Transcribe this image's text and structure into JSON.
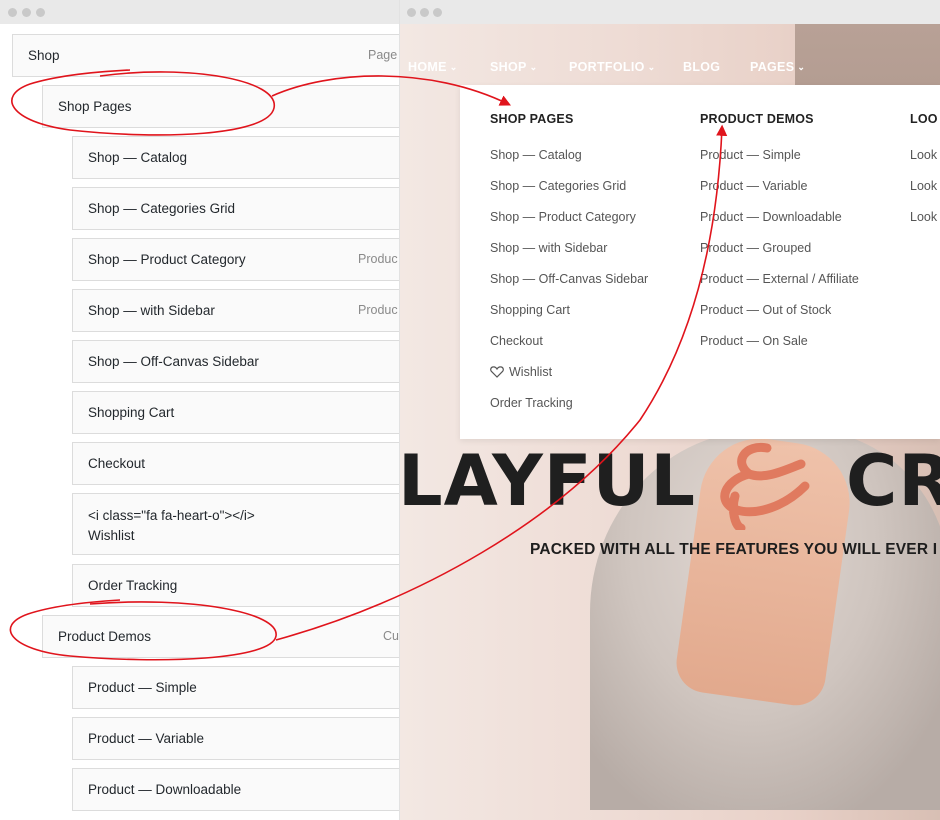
{
  "menu_editor": {
    "items": [
      {
        "label": "Shop",
        "type": "Page"
      },
      {
        "label": "Shop Pages",
        "type": ""
      },
      {
        "label": "Shop — Catalog",
        "type": ""
      },
      {
        "label": "Shop — Categories Grid",
        "type": ""
      },
      {
        "label": "Shop — Product Category",
        "type": "Produc"
      },
      {
        "label": "Shop — with Sidebar",
        "type": "Produc"
      },
      {
        "label": "Shop — Off-Canvas Sidebar",
        "type": ""
      },
      {
        "label": "Shopping Cart",
        "type": ""
      },
      {
        "label": "Checkout",
        "type": ""
      },
      {
        "label_line1": "<i class=\"fa fa-heart-o\"></i>",
        "label_line2": "Wishlist",
        "type": ""
      },
      {
        "label": "Order Tracking",
        "type": ""
      },
      {
        "label": "Product Demos",
        "type": "Cu"
      },
      {
        "label": "Product — Simple",
        "type": ""
      },
      {
        "label": "Product — Variable",
        "type": ""
      },
      {
        "label": "Product — Downloadable",
        "type": ""
      }
    ]
  },
  "site": {
    "nav": [
      {
        "label": "HOME",
        "has_dropdown": true
      },
      {
        "label": "SHOP",
        "has_dropdown": true
      },
      {
        "label": "PORTFOLIO",
        "has_dropdown": true
      },
      {
        "label": "BLOG",
        "has_dropdown": false
      },
      {
        "label": "PAGES",
        "has_dropdown": true
      }
    ],
    "mega_menu": {
      "columns": [
        {
          "heading": "SHOP PAGES",
          "links": [
            "Shop — Catalog",
            "Shop — Categories Grid",
            "Shop — Product Category",
            "Shop — with Sidebar",
            "Shop — Off-Canvas Sidebar",
            "Shopping Cart",
            "Checkout",
            "Wishlist",
            "Order Tracking"
          ]
        },
        {
          "heading": "PRODUCT DEMOS",
          "links": [
            "Product — Simple",
            "Product — Variable",
            "Product — Downloadable",
            "Product — Grouped",
            "Product — External / Affiliate",
            "Product — Out of Stock",
            "Product — On Sale"
          ]
        },
        {
          "heading": "LOO",
          "links": [
            "Look",
            "Look",
            "Look"
          ]
        }
      ]
    },
    "hero": {
      "headline_left": "LAYFUL",
      "headline_right": "CR",
      "tagline": "PACKED WITH ALL THE FEATURES YOU WILL EVER I"
    },
    "colors": {
      "annotation_red": "#e0141c",
      "ampersand": "#e07a5f"
    }
  }
}
